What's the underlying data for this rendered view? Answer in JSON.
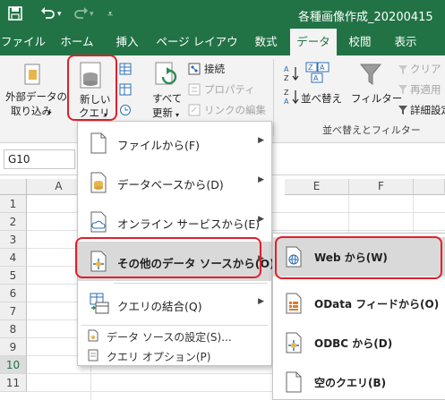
{
  "titlebar": {
    "title": "各種画像作成_20200415"
  },
  "icons": {
    "save": "save-icon",
    "undo": "undo-icon",
    "redo": "redo-icon",
    "customize": "qat-customize-icon"
  },
  "tabs": [
    {
      "label": "ファイル"
    },
    {
      "label": "ホーム"
    },
    {
      "label": "挿入"
    },
    {
      "label": "ページ レイアウト"
    },
    {
      "label": "数式"
    },
    {
      "label": "データ"
    },
    {
      "label": "校閲"
    },
    {
      "label": "表示"
    }
  ],
  "ribbon": {
    "external_data_line1": "外部データの",
    "external_data_line2": "取り込み",
    "new_query_line1": "新しい",
    "new_query_line2": "クエリ",
    "refresh_all_line1": "すべて",
    "refresh_all_line2": "更新",
    "connections": "接続",
    "properties": "プロパティ",
    "edit_links": "リンクの編集",
    "sort": "並べ替え",
    "filter": "フィルター",
    "clear": "クリア",
    "reapply": "再適用",
    "advanced": "詳細設定",
    "sort_filter_group": "並べ替えとフィルター"
  },
  "formula_bar": {
    "name_box": "G10"
  },
  "grid": {
    "columns": [
      "A",
      "E",
      "F"
    ],
    "rows": [
      "1",
      "2",
      "3",
      "4",
      "5",
      "6",
      "7",
      "8",
      "9",
      "10",
      "11"
    ],
    "selected_row": "10"
  },
  "new_query_menu": {
    "items": [
      {
        "label": "ファイルから(F)"
      },
      {
        "label": "データベースから(D)"
      },
      {
        "label": "オンライン サービスから(E)"
      },
      {
        "label": "その他のデータ ソースから(O)"
      },
      {
        "label": "クエリの結合(Q)"
      }
    ],
    "small_items": [
      {
        "label": "データ ソースの設定(S)..."
      },
      {
        "label": "クエリ オプション(P)"
      }
    ]
  },
  "other_sources_menu": {
    "items": [
      {
        "label": "Web から(W)"
      },
      {
        "label": "OData フィードから(O)"
      },
      {
        "label": "ODBC から(D)"
      },
      {
        "label": "空のクエリ(B)"
      }
    ]
  },
  "colors": {
    "accent": "#217346",
    "highlight_border": "#e0202a"
  }
}
